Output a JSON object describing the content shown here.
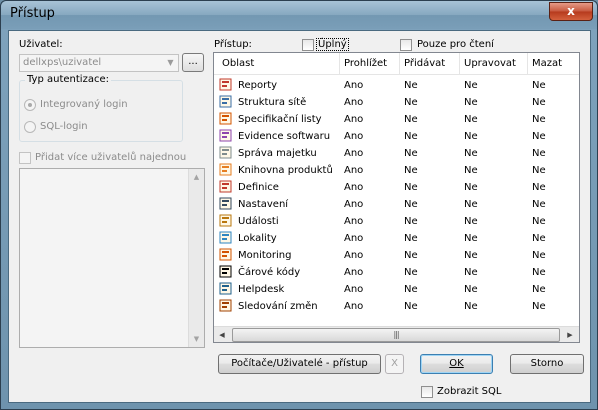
{
  "window": {
    "title": "Přístup",
    "close_label": "x"
  },
  "left": {
    "user_label": "Uživatel:",
    "user_value": "dellxps\\uzivatel",
    "ellipsis_label": "...",
    "auth_group_label": "Typ autentizace:",
    "auth_integrated": "Integrovaný login",
    "auth_sql": "SQL-login",
    "multi_users_label": "Přidat více uživatelů najednou"
  },
  "access": {
    "label": "Přístup:",
    "full_label": "Úplný",
    "readonly_label": "Pouze pro čtení"
  },
  "grid": {
    "columns": [
      "Oblast",
      "Prohlížet",
      "Přidávat",
      "Upravovat",
      "Mazat"
    ],
    "rows": [
      {
        "area": "Reporty",
        "icon": "reports-icon",
        "view": "Ano",
        "add": "Ne",
        "edit": "Ne",
        "del": "Ne"
      },
      {
        "area": "Struktura sítě",
        "icon": "network-structure-icon",
        "view": "Ano",
        "add": "Ne",
        "edit": "Ne",
        "del": "Ne"
      },
      {
        "area": "Specifikační listy",
        "icon": "spec-sheet-icon",
        "view": "Ano",
        "add": "Ne",
        "edit": "Ne",
        "del": "Ne"
      },
      {
        "area": "Evidence softwaru",
        "icon": "software-icon",
        "view": "Ano",
        "add": "Ne",
        "edit": "Ne",
        "del": "Ne"
      },
      {
        "area": "Správa majetku",
        "icon": "asset-tag-icon",
        "view": "Ano",
        "add": "Ne",
        "edit": "Ne",
        "del": "Ne"
      },
      {
        "area": "Knihovna produktů",
        "icon": "product-library-icon",
        "view": "Ano",
        "add": "Ne",
        "edit": "Ne",
        "del": "Ne"
      },
      {
        "area": "Definice",
        "icon": "definitions-icon",
        "view": "Ano",
        "add": "Ne",
        "edit": "Ne",
        "del": "Ne"
      },
      {
        "area": "Nastavení",
        "icon": "settings-tools-icon",
        "view": "Ano",
        "add": "Ne",
        "edit": "Ne",
        "del": "Ne"
      },
      {
        "area": "Události",
        "icon": "events-icon",
        "view": "Ano",
        "add": "Ne",
        "edit": "Ne",
        "del": "Ne"
      },
      {
        "area": "Lokality",
        "icon": "locations-icon",
        "view": "Ano",
        "add": "Ne",
        "edit": "Ne",
        "del": "Ne"
      },
      {
        "area": "Monitoring",
        "icon": "monitoring-icon",
        "view": "Ano",
        "add": "Ne",
        "edit": "Ne",
        "del": "Ne"
      },
      {
        "area": "Čárové kódy",
        "icon": "barcode-icon",
        "view": "Ano",
        "add": "Ne",
        "edit": "Ne",
        "del": "Ne"
      },
      {
        "area": "Helpdesk",
        "icon": "helpdesk-icon",
        "view": "Ano",
        "add": "Ne",
        "edit": "Ne",
        "del": "Ne"
      },
      {
        "area": "Sledování změn",
        "icon": "change-tracking-icon",
        "view": "Ano",
        "add": "Ne",
        "edit": "Ne",
        "del": "Ne"
      }
    ]
  },
  "buttons": {
    "computers_users": "Počítače/Uživatelé - přístup",
    "clear": "X",
    "ok": "OK",
    "cancel": "Storno"
  },
  "show_sql_label": "Zobrazit SQL",
  "colors": {
    "accent": "#3c7fb1",
    "close_red": "#c85a40",
    "title_bar": "#86a8c0"
  }
}
